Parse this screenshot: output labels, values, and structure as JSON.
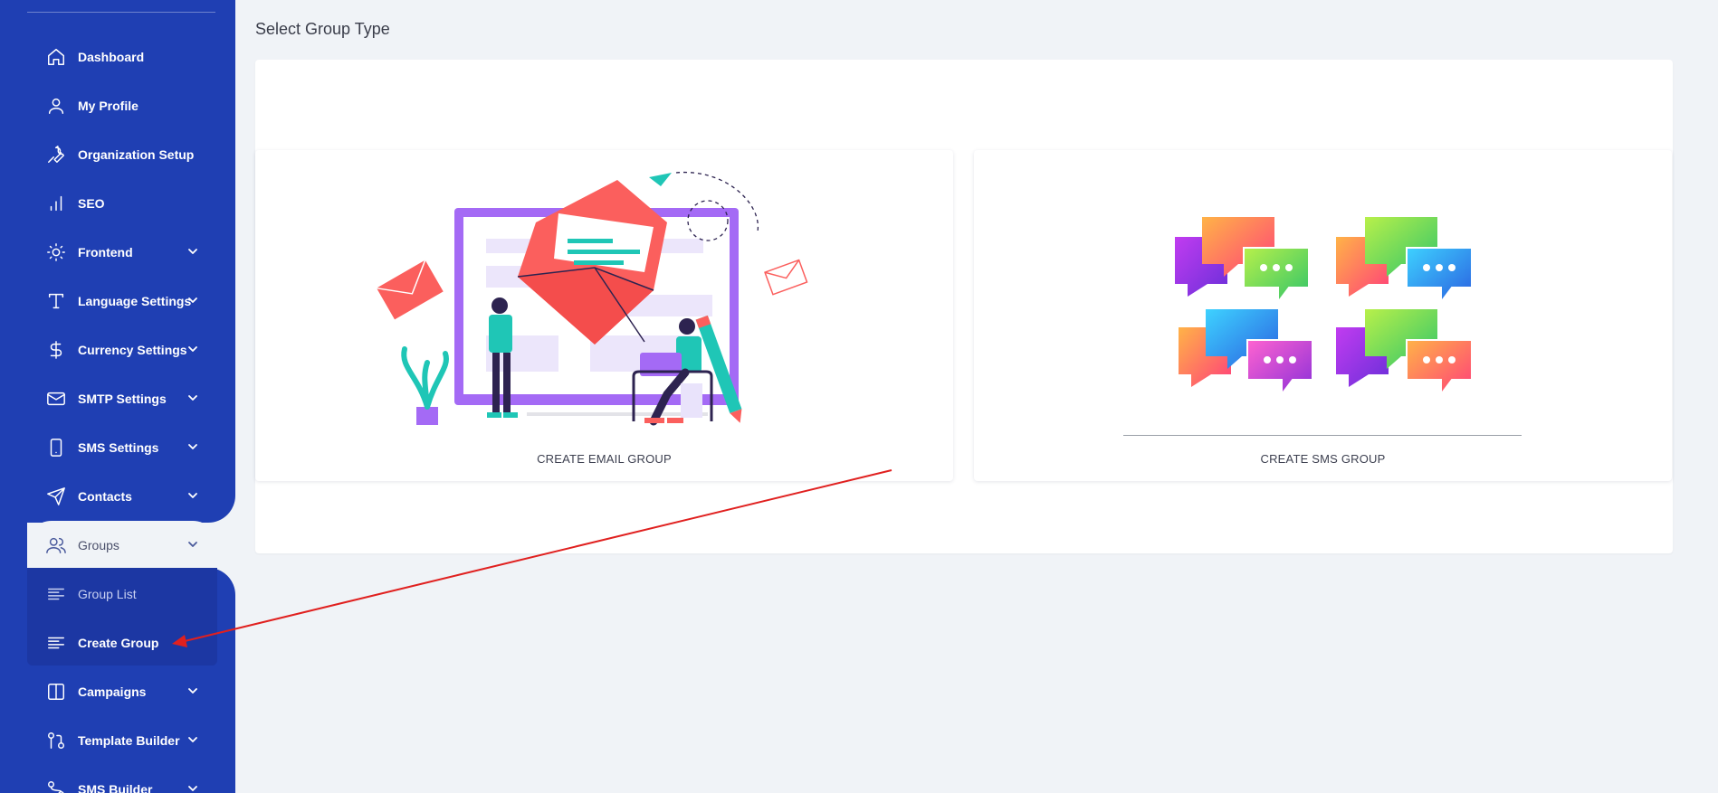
{
  "sidebar": {
    "items": [
      {
        "label": "Dashboard",
        "icon": "home-icon"
      },
      {
        "label": "My Profile",
        "icon": "user-icon"
      },
      {
        "label": "Organization Setup",
        "icon": "wrench-icon"
      },
      {
        "label": "SEO",
        "icon": "bar-chart-icon"
      },
      {
        "label": "Frontend",
        "icon": "sun-icon"
      },
      {
        "label": "Language Settings",
        "icon": "type-icon"
      },
      {
        "label": "Currency Settings",
        "icon": "dollar-icon"
      },
      {
        "label": "SMTP Settings",
        "icon": "mail-icon"
      },
      {
        "label": "SMS Settings",
        "icon": "smartphone-icon"
      },
      {
        "label": "Contacts",
        "icon": "send-icon"
      },
      {
        "label": "Groups",
        "icon": "users-icon"
      },
      {
        "label": "Campaigns",
        "icon": "columns-icon"
      },
      {
        "label": "Template Builder",
        "icon": "git-pull-request-icon"
      },
      {
        "label": "SMS Builder",
        "icon": "git-branch-icon"
      }
    ],
    "groups_submenu": [
      {
        "label": "Group List",
        "icon": "align-left-icon"
      },
      {
        "label": "Create Group",
        "icon": "align-left-icon"
      }
    ]
  },
  "main": {
    "title": "Select Group Type",
    "cards": {
      "email_label": "CREATE EMAIL GROUP",
      "sms_label": "CREATE SMS GROUP"
    }
  },
  "colors": {
    "sidebar_bg": "#1f3fb3",
    "page_bg": "#f0f3f7",
    "annotation_arrow": "#e0201f"
  }
}
